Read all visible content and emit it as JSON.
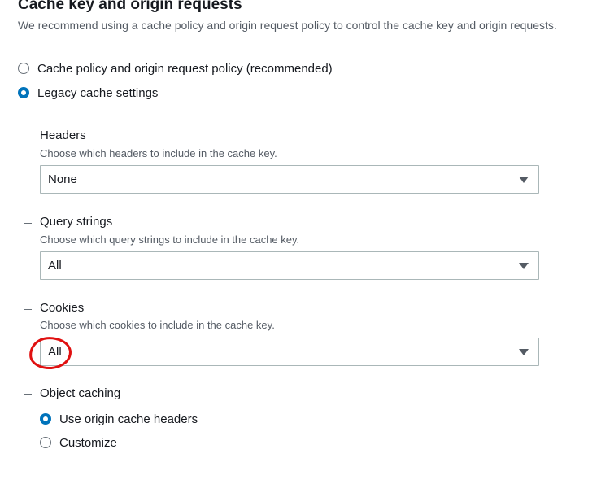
{
  "section": {
    "title": "Cache key and origin requests",
    "subtitle": "We recommend using a cache policy and origin request policy to control the cache key and origin requests."
  },
  "cache_mode": {
    "options": [
      {
        "label": "Cache policy and origin request policy (recommended)",
        "checked": false
      },
      {
        "label": "Legacy cache settings",
        "checked": true
      }
    ]
  },
  "headers": {
    "label": "Headers",
    "description": "Choose which headers to include in the cache key.",
    "value": "None"
  },
  "query_strings": {
    "label": "Query strings",
    "description": "Choose which query strings to include in the cache key.",
    "value": "All"
  },
  "cookies": {
    "label": "Cookies",
    "description": "Choose which cookies to include in the cache key.",
    "value": "All"
  },
  "object_caching": {
    "label": "Object caching",
    "options": [
      {
        "label": "Use origin cache headers",
        "checked": true
      },
      {
        "label": "Customize",
        "checked": false
      }
    ]
  },
  "colors": {
    "accent": "#0073bb",
    "annotation": "#e01010"
  }
}
